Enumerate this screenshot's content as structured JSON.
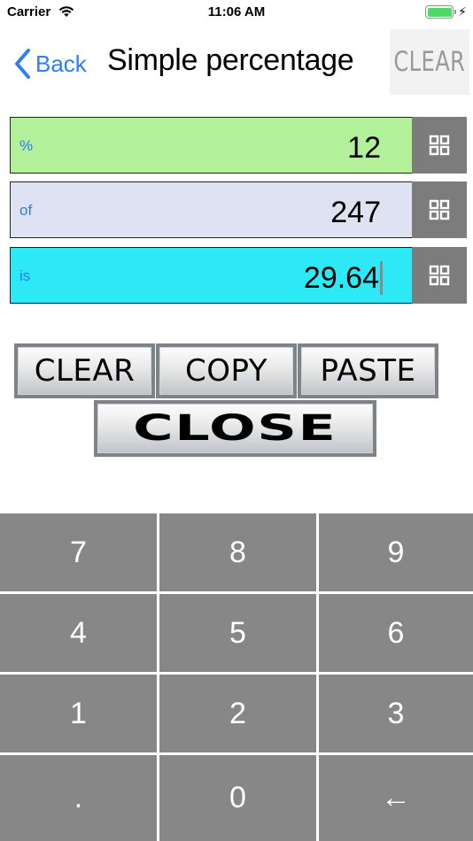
{
  "status_bar": {
    "carrier": "Carrier",
    "time": "11:06 AM"
  },
  "nav": {
    "back_label": "Back",
    "title": "Simple percentage",
    "clear_label": "CLEAR"
  },
  "fields": [
    {
      "label": "%",
      "value": "12",
      "color": "#b3f09a"
    },
    {
      "label": "of",
      "value": "247",
      "color": "#dfe2f2"
    },
    {
      "label": "is",
      "value": "29.64",
      "color": "#2de8f5"
    }
  ],
  "actions": {
    "clear": "CLEAR",
    "copy": "COPY",
    "paste": "PASTE",
    "close": "CLOSE"
  },
  "keypad": {
    "keys": [
      "7",
      "8",
      "9",
      "4",
      "5",
      "6",
      "1",
      "2",
      "3",
      ".",
      "0",
      "←"
    ]
  },
  "colors": {
    "accent": "#2f7cf6",
    "key_bg": "#878787",
    "grid_btn_bg": "#7c7c7c"
  }
}
